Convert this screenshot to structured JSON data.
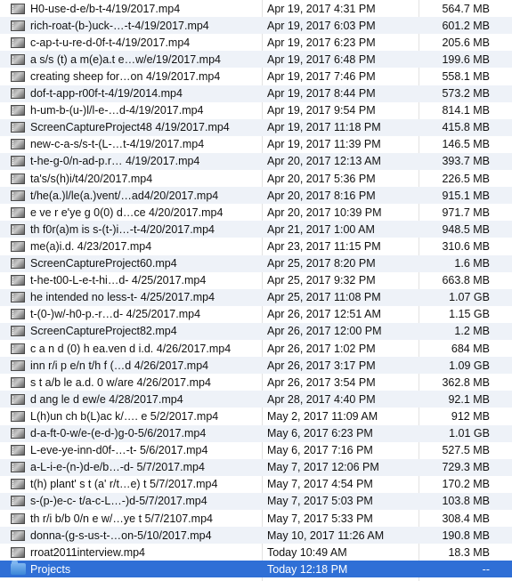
{
  "files": [
    {
      "name": "H0-use-d-e/b-t-4/19/2017.mp4",
      "date": "Apr 19, 2017 4:31 PM",
      "size": "564.7 MB",
      "icon": "video-file-icon"
    },
    {
      "name": "rich-roat-(b-)uck-…-t-4/19/2017.mp4",
      "date": "Apr 19, 2017 6:03 PM",
      "size": "601.2 MB",
      "icon": "video-file-icon"
    },
    {
      "name": "c-ap-t-u-re-d-0f-t-4/19/2017.mp4",
      "date": "Apr 19, 2017 6:23 PM",
      "size": "205.6 MB",
      "icon": "video-file-icon"
    },
    {
      "name": "a s/s (t) a m(e)a.t e…w/e/19/2017.mp4",
      "date": "Apr 19, 2017 6:48 PM",
      "size": "199.6 MB",
      "icon": "video-file-icon"
    },
    {
      "name": "creating sheep for…on 4/19/2017.mp4",
      "date": "Apr 19, 2017 7:46 PM",
      "size": "558.1 MB",
      "icon": "video-file-icon"
    },
    {
      "name": "dof-t-app-r00f-t-4/19/2014.mp4",
      "date": "Apr 19, 2017 8:44 PM",
      "size": "573.2 MB",
      "icon": "video-file-icon"
    },
    {
      "name": "h-um-b-(u-)l/l-e-…d-4/19/2017.mp4",
      "date": "Apr 19, 2017 9:54 PM",
      "size": "814.1 MB",
      "icon": "video-file-icon"
    },
    {
      "name": "ScreenCaptureProject48 4/19/2017.mp4",
      "date": "Apr 19, 2017 11:18 PM",
      "size": "415.8 MB",
      "icon": "video-file-icon"
    },
    {
      "name": "new-c-a-s/s-t-(L-…t-4/19/2017.mp4",
      "date": "Apr 19, 2017 11:39 PM",
      "size": "146.5 MB",
      "icon": "video-file-icon"
    },
    {
      "name": "t-he-g-0/n-ad-p.r… 4/19/2017.mp4",
      "date": "Apr 20, 2017 12:13 AM",
      "size": "393.7 MB",
      "icon": "video-file-icon"
    },
    {
      "name": "ta's/s(h)i/t4/20/2017.mp4",
      "date": "Apr 20, 2017 5:36 PM",
      "size": "226.5 MB",
      "icon": "video-file-icon"
    },
    {
      "name": "t/he(a.)l/le(a.)vent/…ad4/20/2017.mp4",
      "date": "Apr 20, 2017 8:16 PM",
      "size": "915.1 MB",
      "icon": "video-file-icon"
    },
    {
      "name": "e ve r e'ye g 0(0) d…ce 4/20/2017.mp4",
      "date": "Apr 20, 2017 10:39 PM",
      "size": "971.7 MB",
      "icon": "video-file-icon"
    },
    {
      "name": "th f0r(a)m is s-(t-)i…-t-4/20/2017.mp4",
      "date": "Apr 21, 2017 1:00 AM",
      "size": "948.5 MB",
      "icon": "video-file-icon"
    },
    {
      "name": "me(a)i.d. 4/23/2017.mp4",
      "date": "Apr 23, 2017 11:15 PM",
      "size": "310.6 MB",
      "icon": "video-file-icon"
    },
    {
      "name": "ScreenCaptureProject60.mp4",
      "date": "Apr 25, 2017 8:20 PM",
      "size": "1.6 MB",
      "icon": "video-file-icon"
    },
    {
      "name": "t-he-t00-L-e-t-hi…d- 4/25/2017.mp4",
      "date": "Apr 25, 2017 9:32 PM",
      "size": "663.8 MB",
      "icon": "video-file-icon"
    },
    {
      "name": "he intended no less-t- 4/25/2017.mp4",
      "date": "Apr 25, 2017 11:08 PM",
      "size": "1.07 GB",
      "icon": "video-file-icon"
    },
    {
      "name": " t-(0-)w/-h0-p.-r…d- 4/25/2017.mp4",
      "date": "Apr 26, 2017 12:51 AM",
      "size": "1.15 GB",
      "icon": "video-file-icon"
    },
    {
      "name": "ScreenCaptureProject82.mp4",
      "date": "Apr 26, 2017 12:00 PM",
      "size": "1.2 MB",
      "icon": "video-file-icon"
    },
    {
      "name": "c a n d (0) h ea.ven d i.d. 4/26/2017.mp4",
      "date": "Apr 26, 2017 1:02 PM",
      "size": "684 MB",
      "icon": "video-file-icon"
    },
    {
      "name": "inn r/i p e/n t/h f (…d 4/26/2017.mp4",
      "date": "Apr 26, 2017 3:17 PM",
      "size": "1.09 GB",
      "icon": "video-file-icon"
    },
    {
      "name": "s t a/b le a.d. 0 w/are 4/26/2017.mp4",
      "date": "Apr 26, 2017 3:54 PM",
      "size": "362.8 MB",
      "icon": "video-file-icon"
    },
    {
      "name": "d ang le d ew/e 4/28/2017.mp4",
      "date": "Apr 28, 2017 4:40 PM",
      "size": "92.1 MB",
      "icon": "video-file-icon"
    },
    {
      "name": "L(h)un ch b(L)ac k/…. e 5/2/2017.mp4",
      "date": "May 2, 2017 11:09 AM",
      "size": "912 MB",
      "icon": "video-file-icon"
    },
    {
      "name": "d-a-ft-0-w/e-(e-d-)g-0-5/6/2017.mp4",
      "date": "May 6, 2017 6:23 PM",
      "size": "1.01 GB",
      "icon": "video-file-icon"
    },
    {
      "name": "L-eve-ye-inn-d0f-…-t- 5/6/2017.mp4",
      "date": "May 6, 2017 7:16 PM",
      "size": "527.5 MB",
      "icon": "video-file-icon"
    },
    {
      "name": "a-L-i-e-(n-)d-e/b…-d- 5/7/2017.mp4",
      "date": "May 7, 2017 12:06 PM",
      "size": "729.3 MB",
      "icon": "video-file-icon"
    },
    {
      "name": "t(h) plant' s t (a' r/t…e) t 5/7/2017.mp4",
      "date": "May 7, 2017 4:54 PM",
      "size": "170.2 MB",
      "icon": "video-file-icon"
    },
    {
      "name": "s-(p-)e-c- t/a-c-L…-)d-5/7/2017.mp4",
      "date": "May 7, 2017 5:03 PM",
      "size": "103.8 MB",
      "icon": "video-file-icon"
    },
    {
      "name": "th r/i b/b 0/n e w/…ye t 5/7/2107.mp4",
      "date": "May 7, 2017 5:33 PM",
      "size": "308.4 MB",
      "icon": "video-file-icon"
    },
    {
      "name": "donna-(g-s-us-t-…on-5/10/2017.mp4",
      "date": "May 10, 2017 11:26 AM",
      "size": "190.8 MB",
      "icon": "video-file-icon"
    },
    {
      "name": "rroat2011interview.mp4",
      "date": "Today 10:49 AM",
      "size": "18.3 MB",
      "icon": "video-file-icon"
    },
    {
      "name": "Projects",
      "date": "Today 12:18 PM",
      "size": "--",
      "icon": "folder-icon",
      "selected": true
    }
  ],
  "colors": {
    "selection": "#2f6fd6",
    "alt_row": "#eef2f8",
    "text": "#111111"
  }
}
